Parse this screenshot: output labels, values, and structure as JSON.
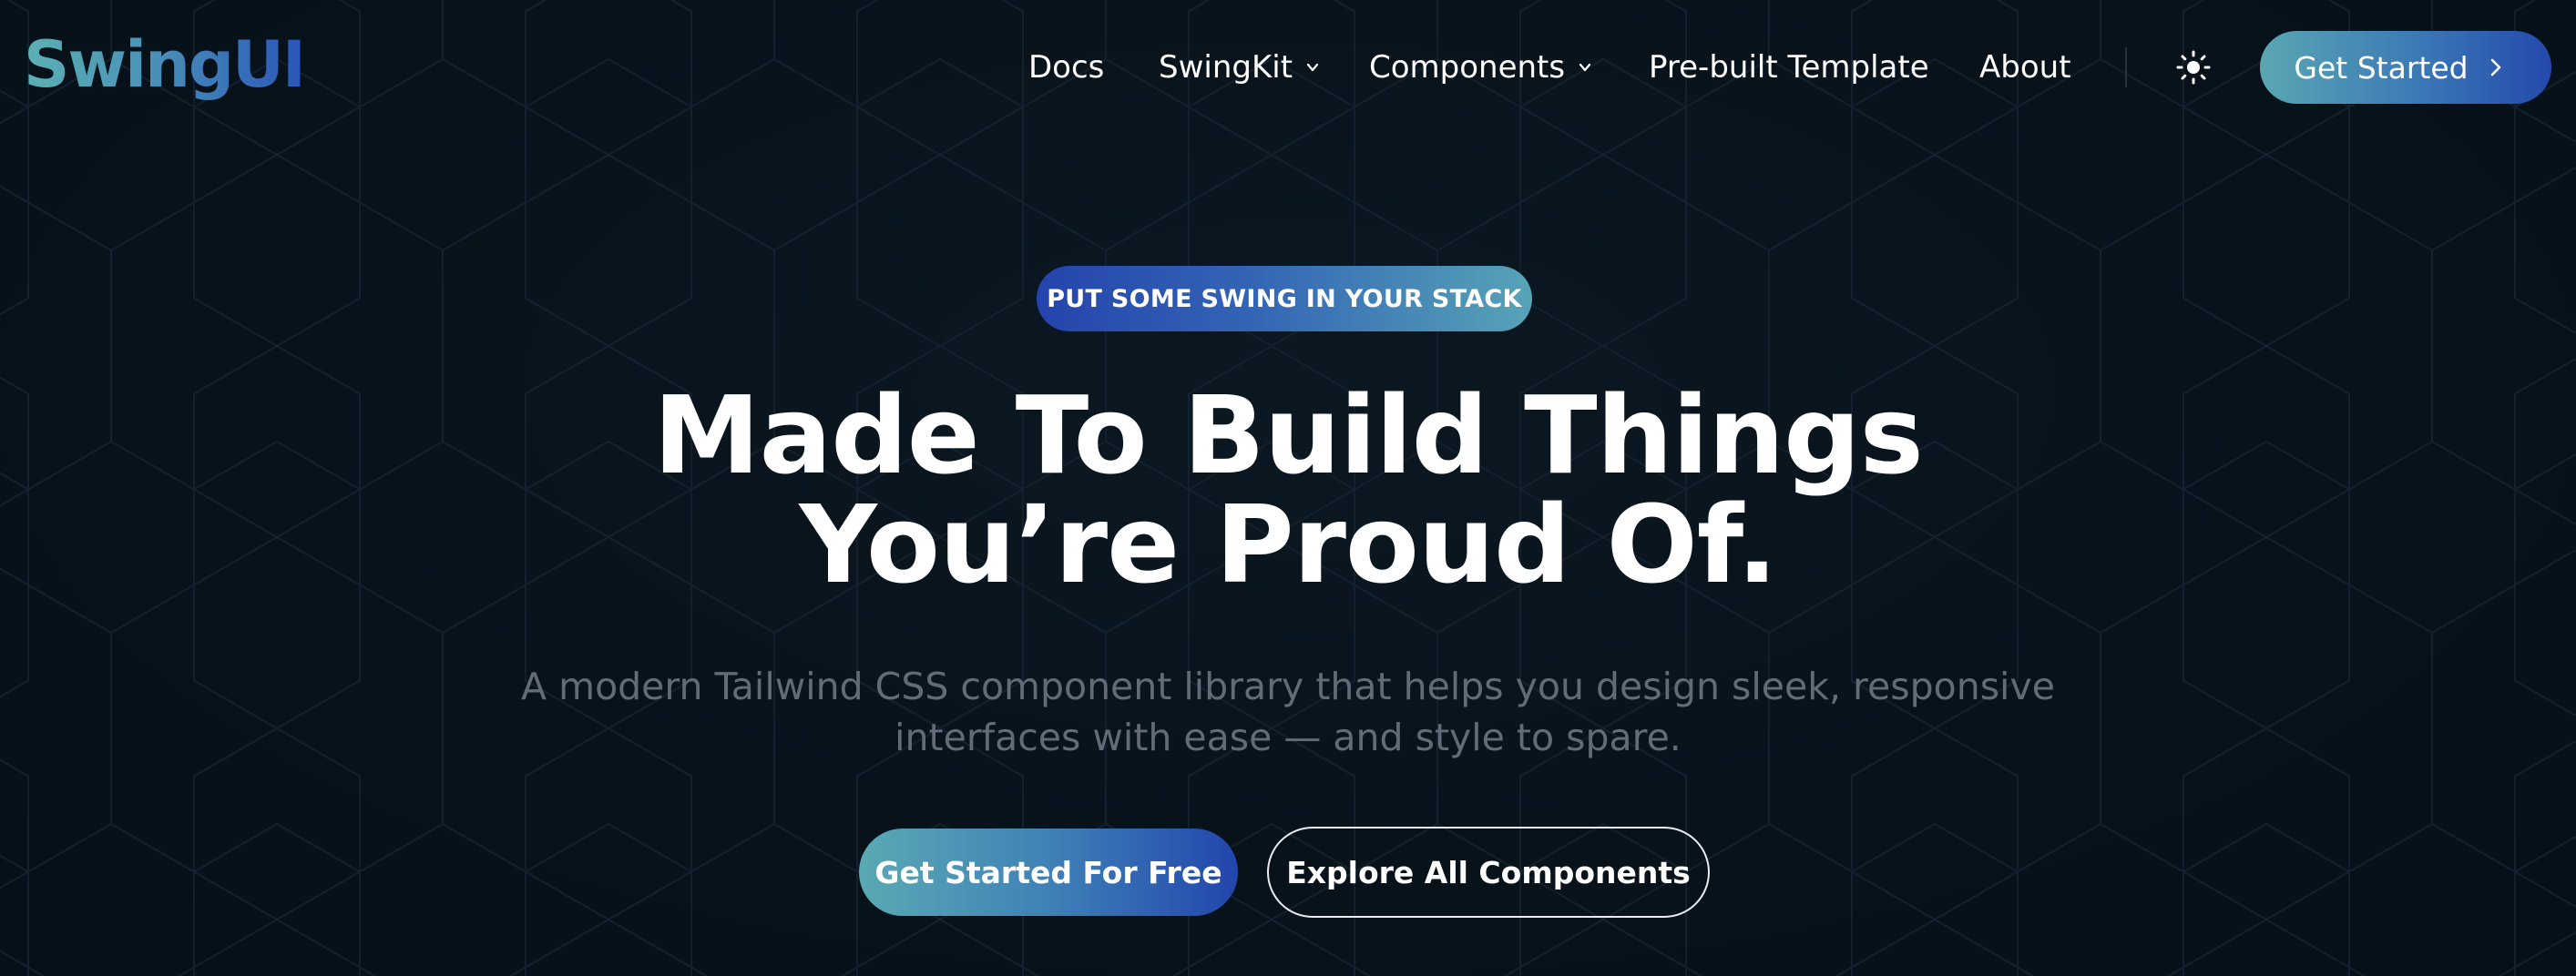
{
  "header": {
    "logo_text": "SwingUI",
    "nav": [
      {
        "label": "Docs"
      },
      {
        "label": "SwingKit"
      },
      {
        "label": "Components"
      },
      {
        "label": "Pre-built Template"
      },
      {
        "label": "About"
      }
    ],
    "theme_toggle_icon": "sun-icon",
    "cta_label": "Get Started"
  },
  "hero": {
    "eyebrow": "PUT SOME SWING IN YOUR STACK",
    "headline_line1": "Made To Build Things",
    "headline_line2": "You’re Proud Of.",
    "subtext_line1": "A modern Tailwind CSS component library that helps you design sleek, responsive",
    "subtext_line2": "interfaces with ease — and style to spare.",
    "primary_cta": "Get Started For Free",
    "secondary_cta": "Explore All Components"
  },
  "colors": {
    "background": "#07111a",
    "accent_teal": "#5aa9b3",
    "accent_blue": "#2245ad",
    "text_primary": "#ffffff",
    "text_muted": "#636c76"
  }
}
